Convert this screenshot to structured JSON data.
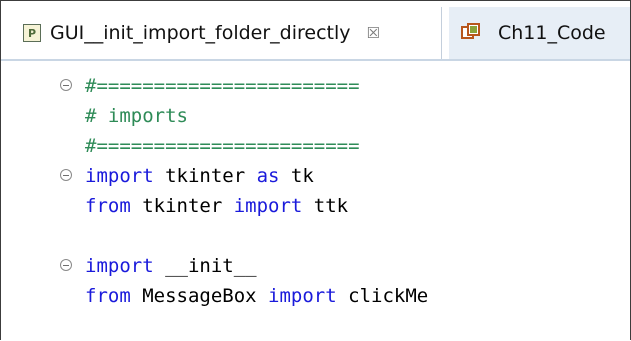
{
  "tabs": [
    {
      "label": "GUI__init_import_folder_directly",
      "icon": "python-file-icon",
      "close_glyph": "☒",
      "active": true
    },
    {
      "label": "Ch11_Code",
      "icon": "package-icon",
      "active": false
    }
  ],
  "code": {
    "lines": [
      {
        "fold": true,
        "tokens": [
          {
            "t": "#=======================",
            "c": "comment"
          }
        ]
      },
      {
        "fold": false,
        "tokens": [
          {
            "t": "# imports",
            "c": "comment"
          }
        ]
      },
      {
        "fold": false,
        "tokens": [
          {
            "t": "#=======================",
            "c": "comment"
          }
        ]
      },
      {
        "fold": true,
        "tokens": [
          {
            "t": "import",
            "c": "keyword"
          },
          {
            "t": " tkinter ",
            "c": "name"
          },
          {
            "t": "as",
            "c": "keyword"
          },
          {
            "t": " tk",
            "c": "name"
          }
        ]
      },
      {
        "fold": false,
        "tokens": [
          {
            "t": "from",
            "c": "keyword"
          },
          {
            "t": " tkinter ",
            "c": "name"
          },
          {
            "t": "import",
            "c": "keyword"
          },
          {
            "t": " ttk",
            "c": "name"
          }
        ]
      },
      {
        "fold": false,
        "tokens": []
      },
      {
        "fold": true,
        "tokens": [
          {
            "t": "import",
            "c": "keyword"
          },
          {
            "t": " __init__",
            "c": "name"
          }
        ]
      },
      {
        "fold": false,
        "tokens": [
          {
            "t": "from",
            "c": "keyword"
          },
          {
            "t": " MessageBox ",
            "c": "name"
          },
          {
            "t": "import",
            "c": "keyword"
          },
          {
            "t": " clickMe",
            "c": "name"
          }
        ]
      }
    ]
  },
  "colors": {
    "comment": "#2e8b57",
    "keyword": "#1a1adb",
    "name": "#000000",
    "tab_strip": "#e7eef6"
  }
}
